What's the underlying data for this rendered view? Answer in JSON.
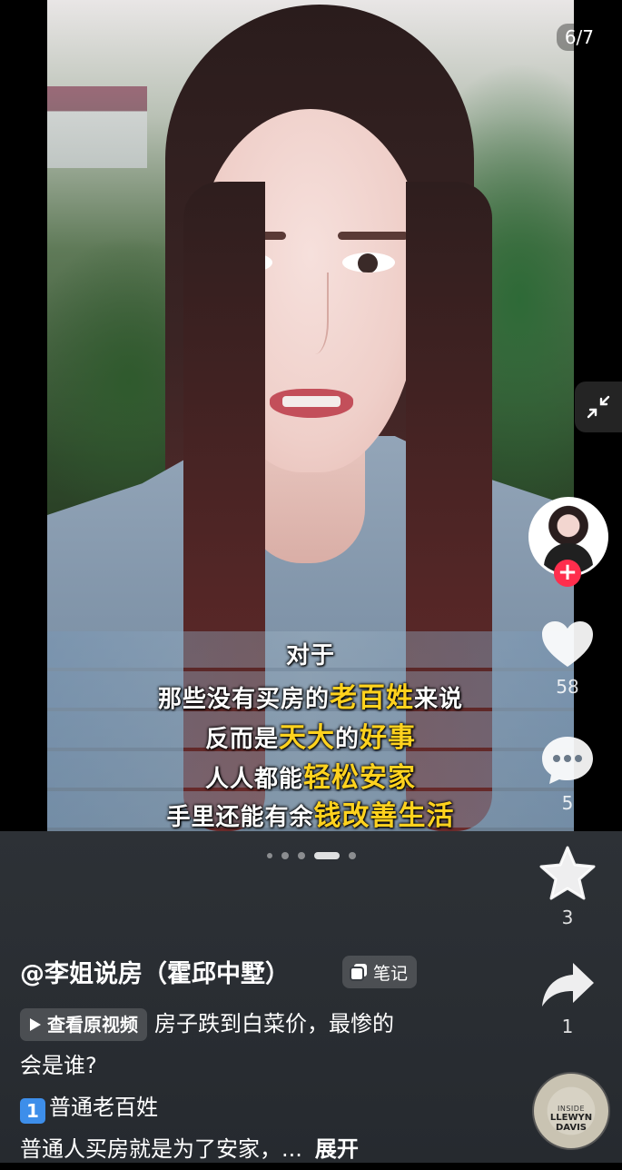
{
  "pager": {
    "label": "6/7"
  },
  "subtitles": [
    {
      "parts": [
        {
          "text": "对于",
          "hl": false
        }
      ]
    },
    {
      "parts": [
        {
          "text": "那些没有买房的",
          "hl": false
        },
        {
          "text": "老百姓",
          "hl": true
        },
        {
          "text": "来说",
          "hl": false
        }
      ]
    },
    {
      "parts": [
        {
          "text": "反而是",
          "hl": false
        },
        {
          "text": "天大",
          "hl": true
        },
        {
          "text": "的",
          "hl": false
        },
        {
          "text": "好事",
          "hl": true
        }
      ]
    },
    {
      "parts": [
        {
          "text": "人人都能",
          "hl": false
        },
        {
          "text": "轻松安家",
          "hl": true
        }
      ]
    },
    {
      "parts": [
        {
          "text": "手里还能有余",
          "hl": false
        },
        {
          "text": "钱改善生活",
          "hl": true
        }
      ]
    }
  ],
  "actions": {
    "like_count": "58",
    "comment_count": "5",
    "favorite_count": "3",
    "share_count": "1"
  },
  "carousel": {
    "count": 5,
    "active_index": 3
  },
  "post": {
    "author": "@李姐说房（霍邱中墅）",
    "note_badge": "笔记",
    "view_original": "查看原视频",
    "desc_line1": "房子跌到白菜价，最惨的",
    "desc_line2": "会是谁?",
    "list_num": "1",
    "list_item": "普通老百姓",
    "desc_line4": "普通人买房就是为了安家，...",
    "expand": "展开"
  },
  "music": {
    "small_text": "INSIDE",
    "title_line1": "LLEWYN",
    "title_line2": "DAVIS"
  },
  "colors": {
    "highlight": "#ffd21e",
    "follow": "#ff2e4d",
    "panel": "#2d3136"
  },
  "icons": [
    "compress-icon",
    "heart-icon",
    "comment-icon",
    "star-icon",
    "share-icon",
    "play-icon",
    "note-icon",
    "plus-icon"
  ]
}
